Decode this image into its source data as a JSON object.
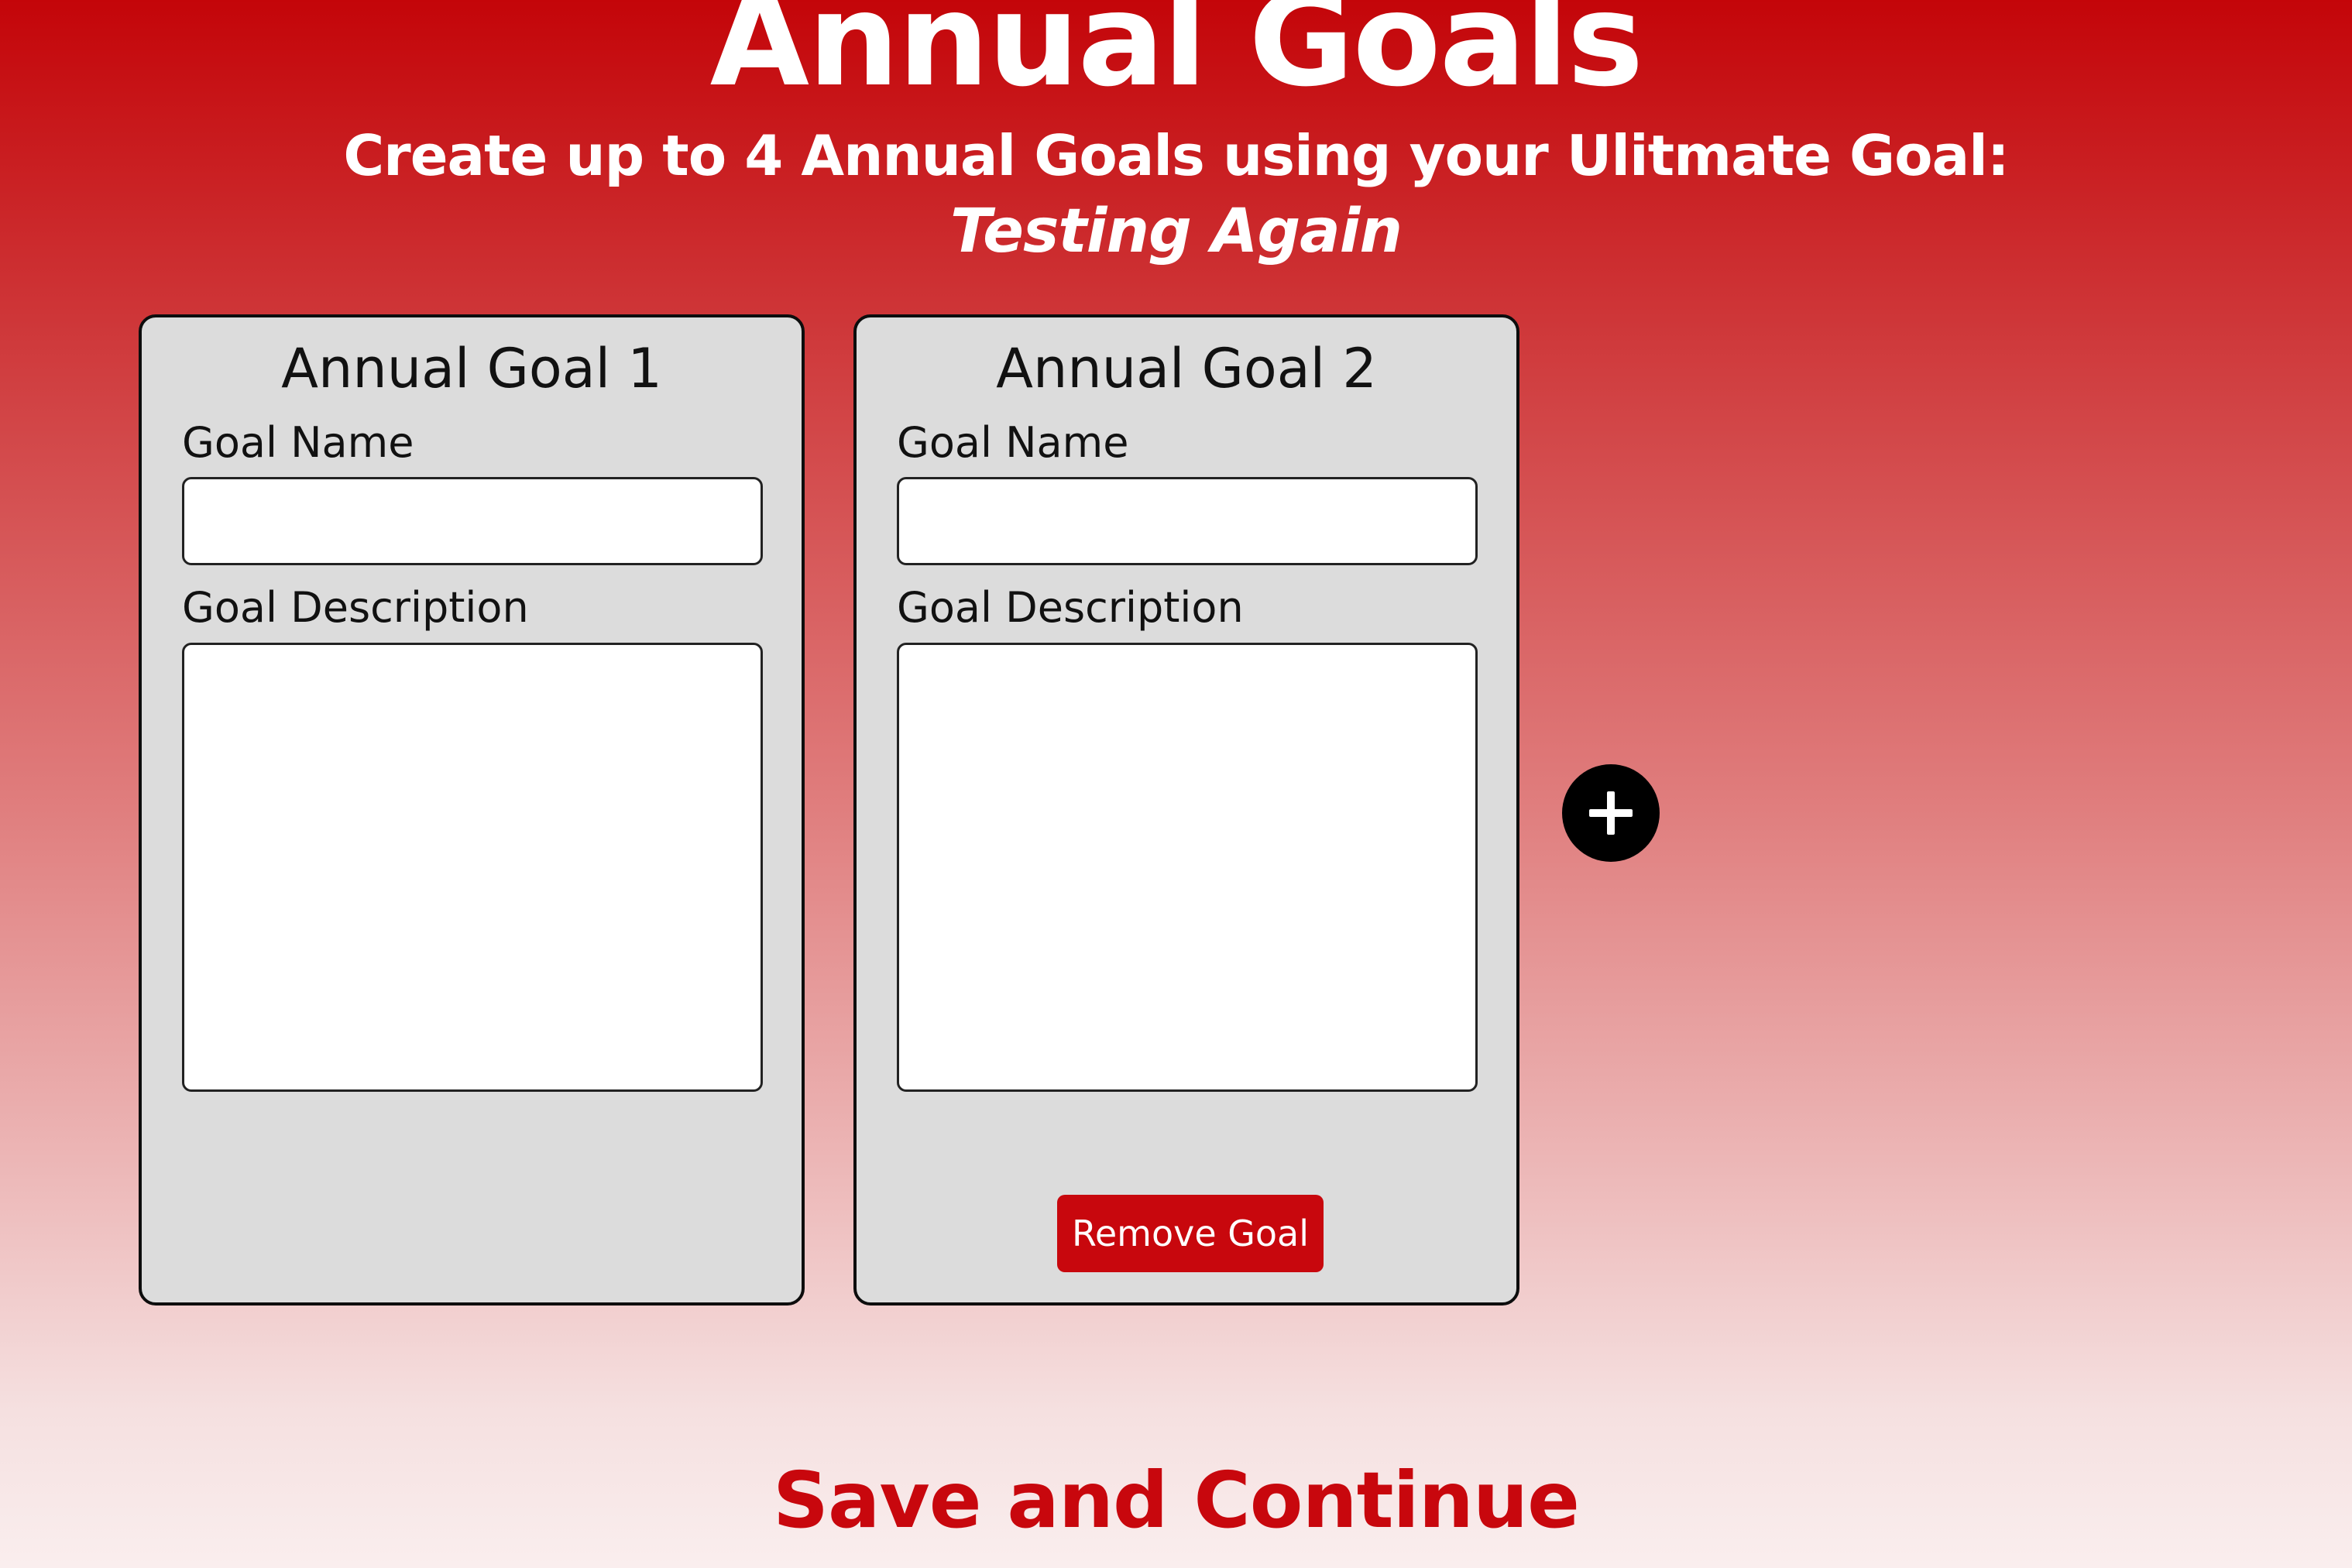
{
  "header": {
    "title": "Annual Goals",
    "subtitle": "Create up to 4 Annual Goals using your Ulitmate Goal:",
    "ultimate_goal": "Testing Again"
  },
  "goals": [
    {
      "title": "Annual Goal 1",
      "name_label": "Goal Name",
      "name_value": "",
      "description_label": "Goal Description",
      "description_value": ""
    },
    {
      "title": "Annual Goal 2",
      "name_label": "Goal Name",
      "name_value": "",
      "description_label": "Goal Description",
      "description_value": "",
      "remove_label": "Remove Goal"
    }
  ],
  "add_goal": {
    "icon": "plus-icon"
  },
  "footer": {
    "save_label": "Save and Continue"
  },
  "colors": {
    "brand_red": "#c8070d",
    "card_background": "#dcdcdc",
    "add_button": "#000000"
  }
}
